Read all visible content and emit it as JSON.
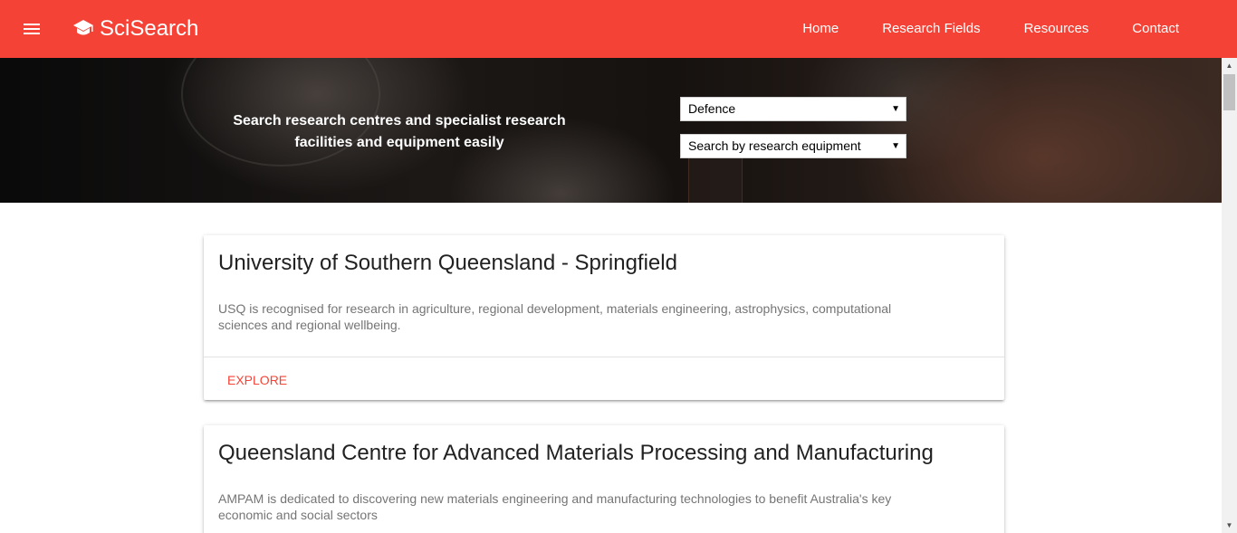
{
  "navbar": {
    "brand": "SciSearch",
    "menu_icon": "hamburger-menu-icon",
    "brand_icon": "graduation-cap-icon",
    "color": "#f44336",
    "links": [
      "Home",
      "Research Fields",
      "Resources",
      "Contact"
    ]
  },
  "hero": {
    "tagline_line1": "Search research centres and specialist research",
    "tagline_line2": "facilities and equipment easily",
    "field_select": "Defence",
    "search_type_select": "Search by research equipment"
  },
  "cards": [
    {
      "title": "University of Southern Queensland - Springfield",
      "description": "USQ is recognised for research in agriculture, regional development, materials engineering, astrophysics, computational sciences and regional wellbeing.",
      "action": "EXPLORE"
    },
    {
      "title": "Queensland Centre for Advanced Materials Processing and Manufacturing",
      "description": "AMPAM is dedicated to discovering new materials engineering and manufacturing technologies to benefit Australia's key economic and social sectors"
    }
  ]
}
